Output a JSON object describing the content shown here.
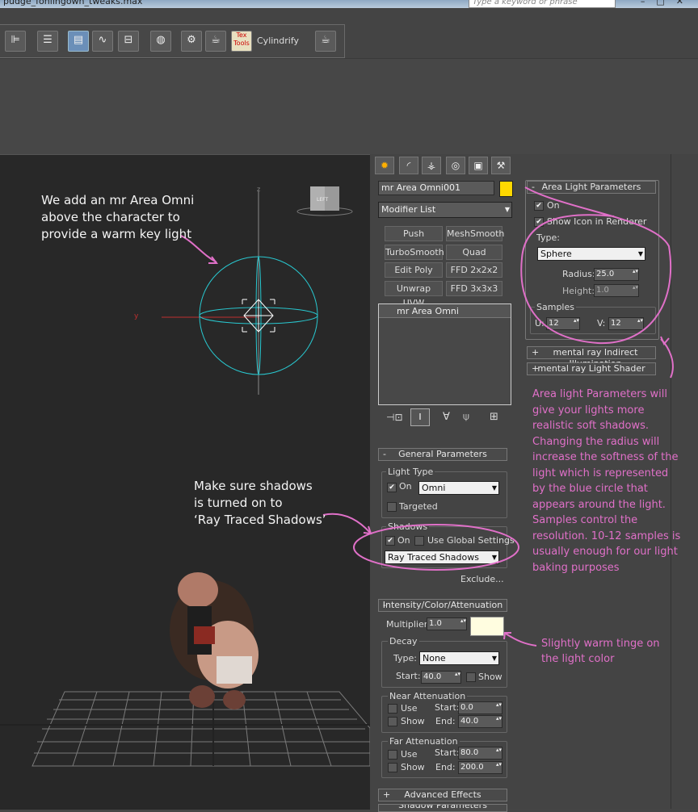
{
  "window": {
    "title": "pudge_fonlingown_tweaks.max",
    "search_placeholder": "Type a keyword or phrase",
    "controls": [
      "–",
      "□",
      "✕"
    ]
  },
  "toolbar": {
    "cylindrify_label": "Cylindrify",
    "texttools_label": "Tex Tools",
    "icons": [
      "align-icon",
      "layer-manager-icon",
      "scene-explorer-icon",
      "curve-editor-icon",
      "schematic-icon",
      "material-editor-icon",
      "render-setup-icon",
      "render-frame-icon",
      "render-icon",
      "texttools-icon",
      "teapot-icon"
    ]
  },
  "viewport": {
    "axis_z": "z",
    "axis_y": "y",
    "viewcube_label": "LEFT"
  },
  "command_panel": {
    "object_name": "mr Area Omni001",
    "object_color": "#ffd800",
    "modifier_list": "Modifier List",
    "modifier_buttons": [
      "Push",
      "MeshSmooth",
      "TurboSmooth",
      "Quad Chamfer",
      "Edit Poly",
      "FFD 2x2x2",
      "Unwrap UVW",
      "FFD 3x3x3"
    ],
    "stack_item": "mr Area Omni"
  },
  "general_parameters": {
    "title": "General Parameters",
    "light_type_group": "Light Type",
    "on_label": "On",
    "light_type": "Omni",
    "targeted_label": "Targeted",
    "shadows_group": "Shadows",
    "shadows_on_label": "On",
    "use_global_label": "Use Global Settings",
    "shadow_type": "Ray Traced Shadows",
    "exclude_button": "Exclude..."
  },
  "intensity": {
    "title": "Intensity/Color/Attenuation",
    "multiplier_label": "Multiplier:",
    "multiplier_value": "1.0",
    "light_color": "#fffde0",
    "decay_group": "Decay",
    "type_label": "Type:",
    "decay_type": "None",
    "start_label": "Start:",
    "decay_start": "40.0",
    "show_label": "Show",
    "near_group": "Near Attenuation",
    "use_label": "Use",
    "end_label": "End:",
    "near_start": "0.0",
    "near_end": "40.0",
    "far_group": "Far Attenuation",
    "far_start": "80.0",
    "far_end": "200.0"
  },
  "advanced_effects": {
    "title": "Advanced Effects",
    "next_title": "Shadow Parameters"
  },
  "area_light": {
    "title": "Area Light Parameters",
    "on_label": "On",
    "show_icon_label": "Show Icon in Renderer",
    "type_label": "Type:",
    "type_value": "Sphere",
    "radius_label": "Radius:",
    "radius_value": "25.0",
    "height_label": "Height:",
    "height_value": "1.0",
    "samples_label": "Samples",
    "u_label": "U:",
    "u_value": "12",
    "v_label": "V:",
    "v_value": "12"
  },
  "rollouts": {
    "indirect_illum": "mental ray Indirect Illumination",
    "light_shader": "mental ray Light Shader"
  },
  "annotations": {
    "omni_note": [
      "We add an mr Area Omni",
      "above the character to",
      "provide a warm key light"
    ],
    "shadows_note": [
      "Make sure shadows",
      "is turned on to",
      "‘Ray Traced Shadows’"
    ],
    "area_note": [
      "Area light Parameters will",
      "give your lights more",
      "realistic soft shadows.",
      "Changing the radius will",
      "increase the softness of the",
      "light which is represented",
      "by the blue circle that",
      "appears around the light.",
      "Samples control the",
      "resolution. 10-12 samples is",
      "usually enough for our light",
      "baking purposes"
    ],
    "color_note": [
      "Slightly warm tinge on",
      "the light color"
    ],
    "annotation_color": "#e070c8"
  }
}
